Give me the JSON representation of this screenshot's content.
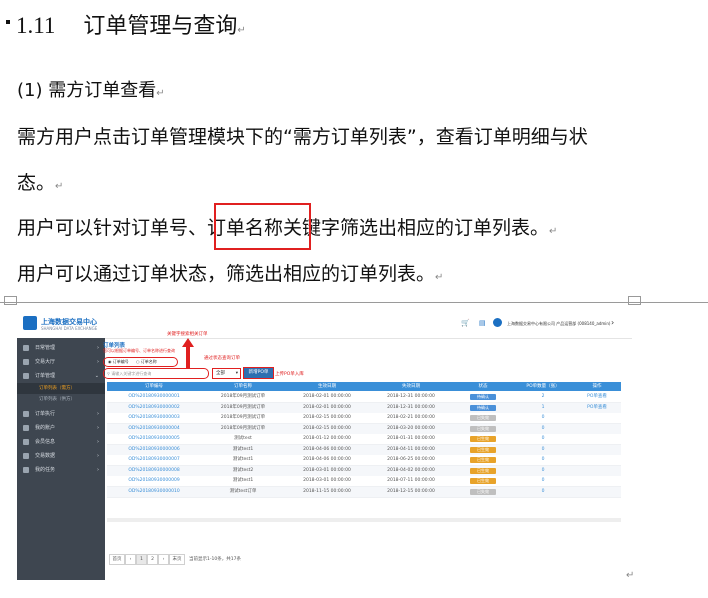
{
  "doc": {
    "heading_number": "1.11",
    "heading_title": "订单管理与查询",
    "subheading": "(1)  需方订单查看",
    "para1_line1": "需方用户点击订单管理模块下的“需方订单列表”，查看订单明细与状",
    "para1_line2": "态。",
    "para2_before": "用户可以针对订单号、",
    "para2_highlight": "订单名称",
    "para2_after": "关键字筛选出相应的订单列表。",
    "para3": "用户可以通过订单状态，筛选出相应的订单列表。",
    "para_mark": "↵"
  },
  "screenshot": {
    "logo_text": "上海数据交易中心",
    "logo_sub": "SHANGHAI DATA EXCHANGE",
    "user_info": "上海数据交易中心有限公司 产品运营部 (008140_admin)",
    "sidebar": [
      {
        "label": "日常管理"
      },
      {
        "label": "交易大厅"
      },
      {
        "label": "订单管理"
      },
      {
        "label": "订单执行"
      },
      {
        "label": "我的账户"
      },
      {
        "label": "会员信息"
      },
      {
        "label": "交易数据"
      },
      {
        "label": "我的任务"
      }
    ],
    "sidebar_sub": [
      {
        "label": "订单列表（需方）"
      },
      {
        "label": "订单列表（供方）"
      }
    ],
    "main_title": "订单列表",
    "main_hint": "您可以根据订单编号、订单名称进行查询",
    "radio_order_no": "订单编号",
    "radio_order_name": "订单名称",
    "search_placeholder": "请输入关键字进行查询",
    "status_select": "全部",
    "new_order_button": "新增PO单",
    "annotations": {
      "keyword": "关键字搜索相关订单",
      "status": "通过状态查询订单",
      "new_po": "上传PO单入库"
    },
    "columns": [
      "订单编号",
      "订单名称",
      "生效日期",
      "失效日期",
      "状态",
      "PO单数量（张）",
      "操作"
    ],
    "rows": [
      {
        "no": "OD%20180930000001",
        "name": "2018年09月测试订单",
        "start": "2018-02-01 00:00:00",
        "end": "2018-12-31 00:00:00",
        "status": "待确认",
        "po": "2",
        "op": "PO单查看"
      },
      {
        "no": "OD%20180930000002",
        "name": "2018年09月测试订单",
        "start": "2018-02-01 00:00:00",
        "end": "2018-12-31 00:00:00",
        "status": "待确认",
        "po": "1",
        "op": "PO单查看"
      },
      {
        "no": "OD%20180930000003",
        "name": "2018年09月测试订单",
        "start": "2018-02-15 00:00:00",
        "end": "2018-02-21 00:00:00",
        "status": "已失效",
        "po": "0",
        "op": ""
      },
      {
        "no": "OD%20180930000004",
        "name": "2018年09月测试订单",
        "start": "2018-02-15 00:00:00",
        "end": "2018-03-20 00:00:00",
        "status": "已失效",
        "po": "0",
        "op": ""
      },
      {
        "no": "OD%20180930000005",
        "name": "测试test",
        "start": "2018-01-12 00:00:00",
        "end": "2018-01-31 00:00:00",
        "status": "已生效",
        "po": "0",
        "op": ""
      },
      {
        "no": "OD%20180930000006",
        "name": "测试test1",
        "start": "2018-04-06 00:00:00",
        "end": "2018-04-11 00:00:00",
        "status": "已生效",
        "po": "0",
        "op": ""
      },
      {
        "no": "OD%20180930000007",
        "name": "测试test1",
        "start": "2018-04-06 00:00:00",
        "end": "2018-06-25 00:00:00",
        "status": "已生效",
        "po": "0",
        "op": ""
      },
      {
        "no": "OD%20180930000008",
        "name": "测试test2",
        "start": "2018-03-01 00:00:00",
        "end": "2018-04-02 00:00:00",
        "status": "已生效",
        "po": "0",
        "op": ""
      },
      {
        "no": "OD%20180930000009",
        "name": "测试test1",
        "start": "2018-03-01 00:00:00",
        "end": "2018-07-11 00:00:00",
        "status": "已生效",
        "po": "0",
        "op": ""
      },
      {
        "no": "OD%20180930000010",
        "name": "测试test订单",
        "start": "2018-11-15 00:00:00",
        "end": "2018-12-15 00:00:00",
        "status": "已失效",
        "po": "0",
        "op": ""
      }
    ],
    "pagination": {
      "first": "首页",
      "prev": "‹",
      "page1": "1",
      "page2": "2",
      "next": "›",
      "last": "末页",
      "info": "当前显示1-10条，共17条"
    },
    "colors": {
      "header_blue": "#3a8fd8",
      "pending": "#4a90d9",
      "expired": "#bfbfbf",
      "active": "#e8a32a",
      "sidebar": "#3e4650",
      "annotation_red": "#e02020"
    }
  }
}
